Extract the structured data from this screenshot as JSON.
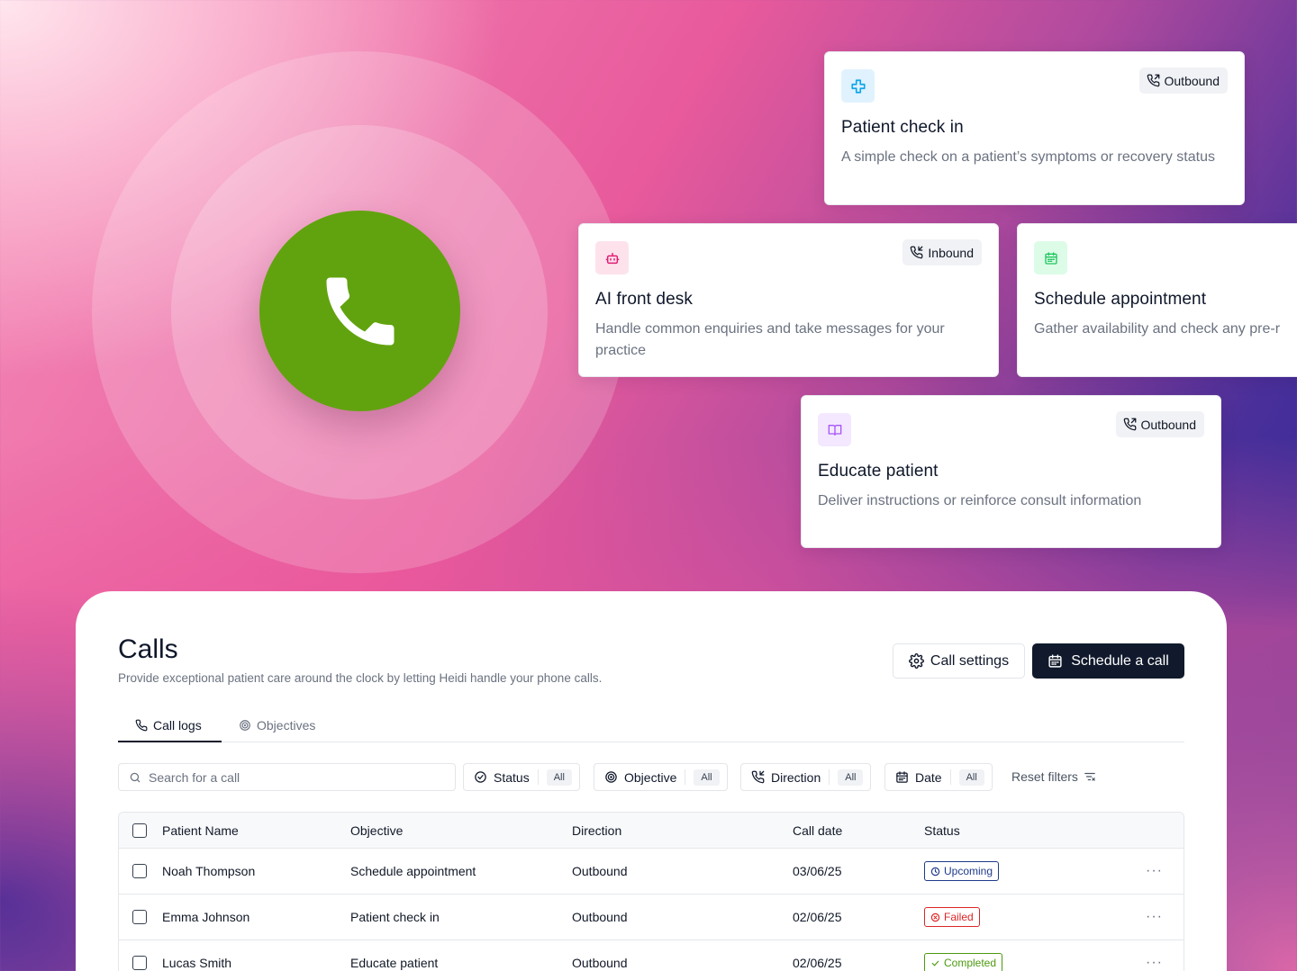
{
  "hero": {
    "call_icon": "phone-icon",
    "call_color": "#61a30e"
  },
  "cards": [
    {
      "key": "check",
      "title": "Patient check in",
      "desc": "A simple check on a patient’s symptoms or recovery status",
      "direction": "Outbound",
      "icon": "plus-icon",
      "icon_bg": "#e0f2fe",
      "icon_color": "#0ea5e9"
    },
    {
      "key": "desk",
      "title": "AI front desk",
      "desc": "Handle common enquiries and take messages for your practice",
      "direction": "Inbound",
      "icon": "robot-icon",
      "icon_bg": "#fde2ec",
      "icon_color": "#e11d74"
    },
    {
      "key": "appt",
      "title": "Schedule appointment",
      "desc": "Gather availability and check any pre-r",
      "direction": "",
      "icon": "calendar-icon",
      "icon_bg": "#dcfce7",
      "icon_color": "#22c55e"
    },
    {
      "key": "edu",
      "title": "Educate patient",
      "desc": "Deliver instructions or reinforce consult information",
      "direction": "Outbound",
      "icon": "book-icon",
      "icon_bg": "#f3e8ff",
      "icon_color": "#a855f7"
    }
  ],
  "panel": {
    "title": "Calls",
    "subtitle": "Provide exceptional patient care around the clock by letting Heidi handle your phone calls.",
    "call_settings_label": "Call settings",
    "schedule_label": "Schedule a call"
  },
  "tabs": [
    {
      "label": "Call logs",
      "active": true
    },
    {
      "label": "Objectives",
      "active": false
    }
  ],
  "search": {
    "placeholder": "Search for a call"
  },
  "filters": [
    {
      "label": "Status",
      "value": "All"
    },
    {
      "label": "Objective",
      "value": "All"
    },
    {
      "label": "Direction",
      "value": "All"
    },
    {
      "label": "Date",
      "value": "All"
    }
  ],
  "reset_label": "Reset filters",
  "table": {
    "columns": [
      "Patient Name",
      "Objective",
      "Direction",
      "Call date",
      "Status"
    ],
    "rows": [
      {
        "name": "Noah Thompson",
        "objective": "Schedule appointment",
        "direction": "Outbound",
        "date": "03/06/25",
        "status": "Upcoming"
      },
      {
        "name": "Emma Johnson",
        "objective": "Patient check in",
        "direction": "Outbound",
        "date": "02/06/25",
        "status": "Failed"
      },
      {
        "name": "Lucas Smith",
        "objective": "Educate patient",
        "direction": "Outbound",
        "date": "02/06/25",
        "status": "Completed"
      }
    ],
    "more_label": "···"
  }
}
